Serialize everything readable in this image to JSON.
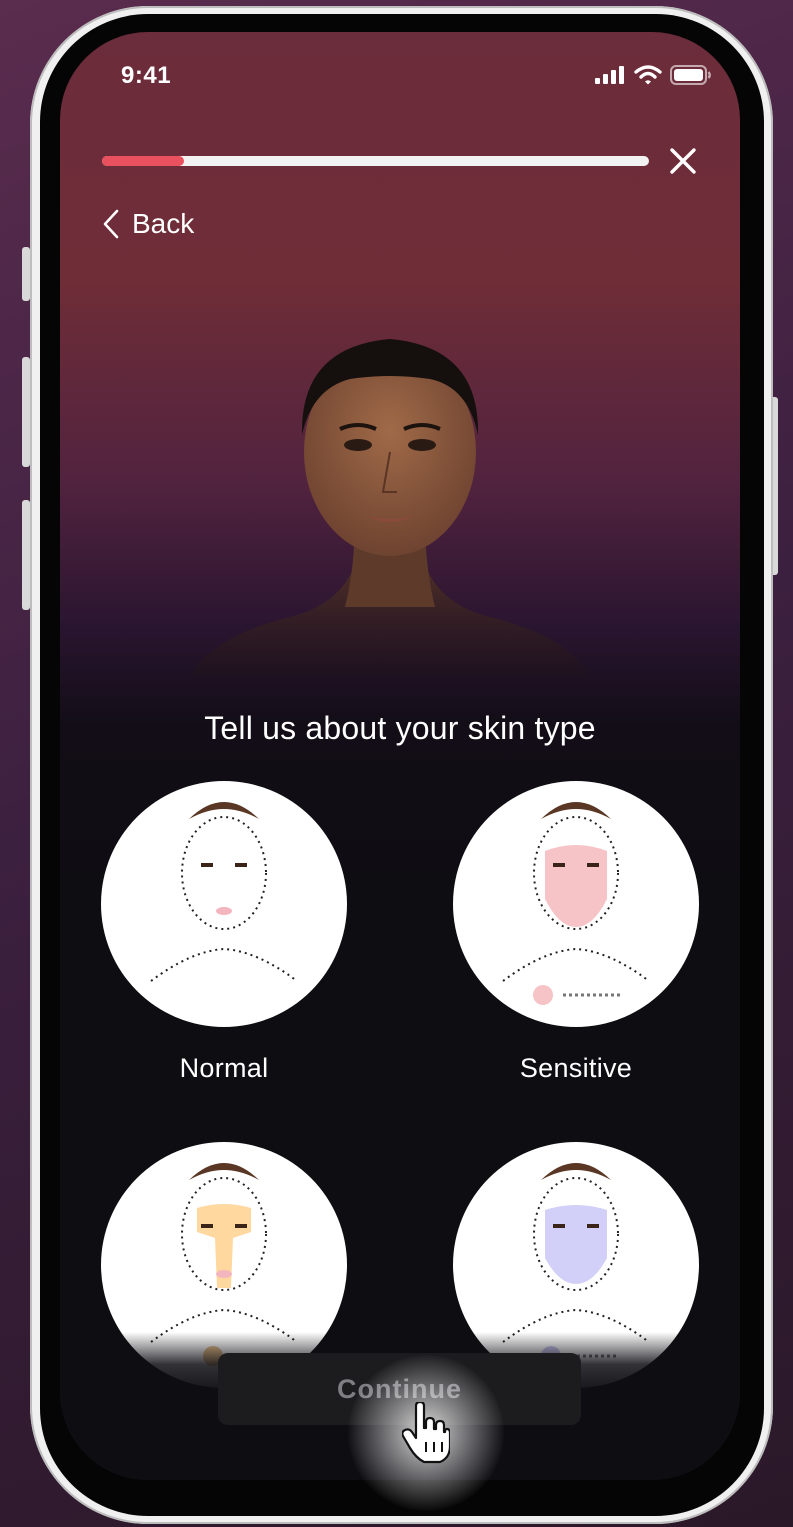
{
  "status_bar": {
    "time": "9:41"
  },
  "progress": {
    "value": 0.15,
    "color": "#e8515d"
  },
  "nav": {
    "back_label": "Back"
  },
  "question": {
    "heading": "Tell us about your skin type"
  },
  "options": [
    {
      "label": "Normal",
      "accent": "#f4b6be"
    },
    {
      "label": "Sensitive",
      "accent": "#f6c3c6"
    },
    {
      "label": "",
      "accent": "#ffd8a0"
    },
    {
      "label": "",
      "accent": "#d2d0f8"
    }
  ],
  "continue_button": {
    "label": "Continue",
    "state": "disabled"
  }
}
